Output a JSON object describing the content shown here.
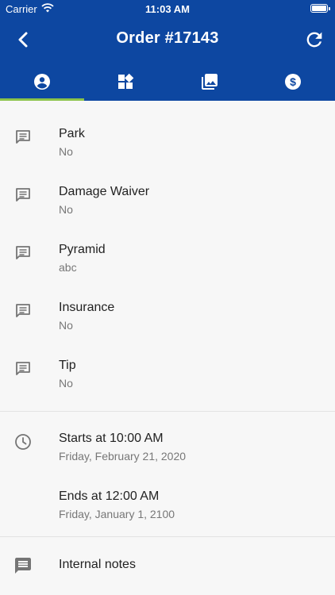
{
  "status_bar": {
    "carrier": "Carrier",
    "time": "11:03 AM"
  },
  "toolbar": {
    "title": "Order #17143"
  },
  "tabs": [
    {
      "icon": "account-circle-icon",
      "active": true
    },
    {
      "icon": "widgets-icon",
      "active": false
    },
    {
      "icon": "photo-library-icon",
      "active": false
    },
    {
      "icon": "dollar-circle-icon",
      "active": false
    }
  ],
  "fields": [
    {
      "label": "Park",
      "value": "No"
    },
    {
      "label": "Damage Waiver",
      "value": "No"
    },
    {
      "label": "Pyramid",
      "value": "abc"
    },
    {
      "label": "Insurance",
      "value": "No"
    },
    {
      "label": "Tip",
      "value": "No"
    }
  ],
  "schedule": {
    "start_label": "Starts at 10:00 AM",
    "start_date": "Friday, February 21, 2020",
    "end_label": "Ends at 12:00 AM",
    "end_date": "Friday, January 1, 2100"
  },
  "notes": {
    "label": "Internal notes"
  },
  "colors": {
    "appbar": "#0d47a1",
    "tab_indicator": "#8bc34a"
  }
}
